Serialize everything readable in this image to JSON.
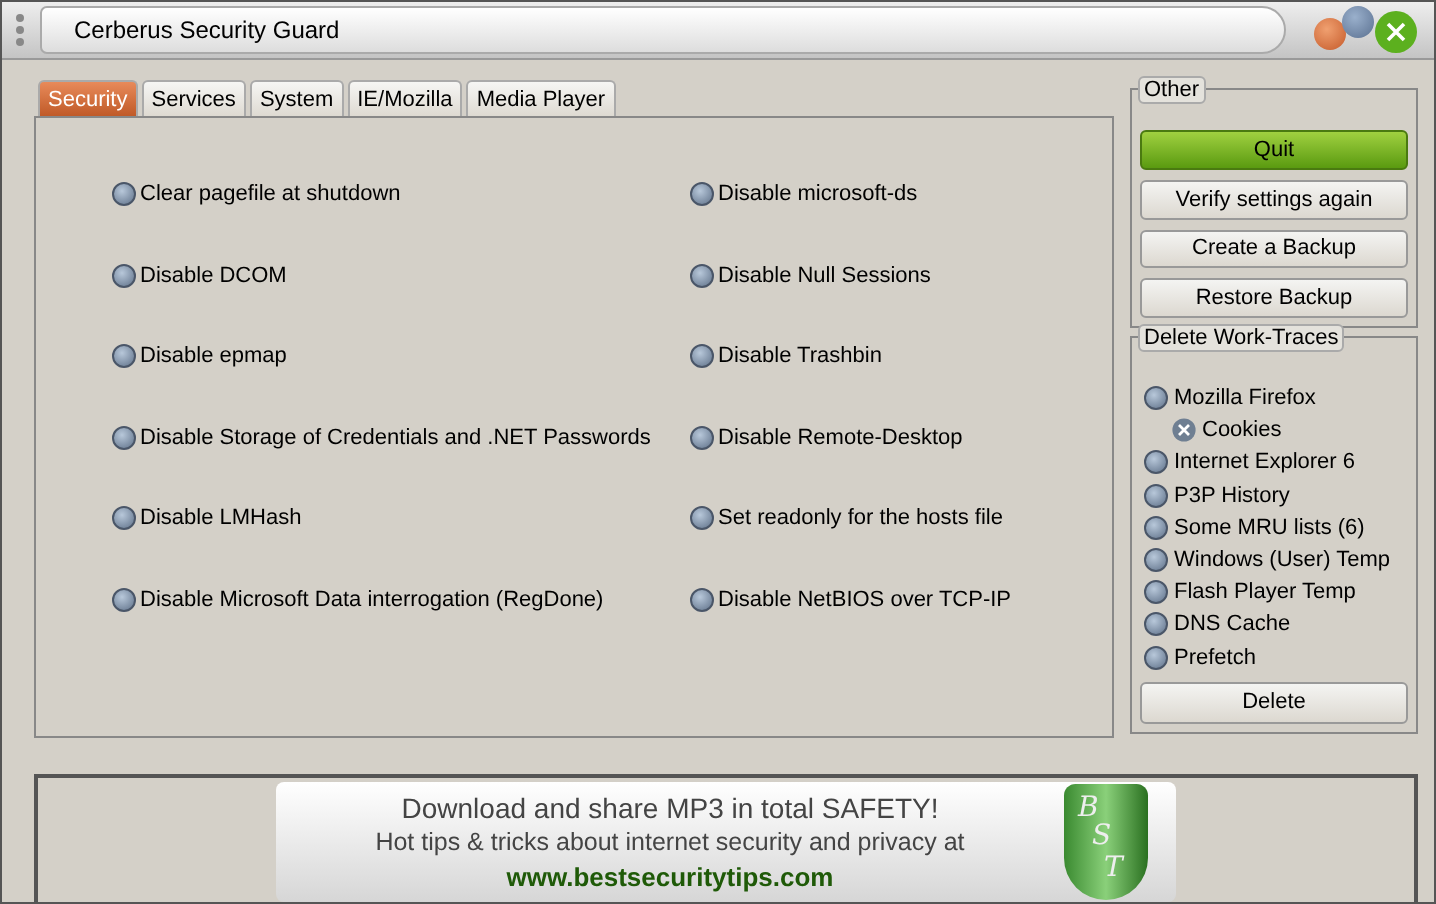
{
  "window": {
    "title": "Cerberus Security Guard"
  },
  "tabs": [
    {
      "label": "Security",
      "selected": true
    },
    {
      "label": "Services",
      "selected": false
    },
    {
      "label": "System",
      "selected": false
    },
    {
      "label": "IE/Mozilla",
      "selected": false
    },
    {
      "label": "Media Player",
      "selected": false
    }
  ],
  "options_left": [
    {
      "label": "Clear pagefile at shutdown",
      "checked": false
    },
    {
      "label": "Disable DCOM",
      "checked": false
    },
    {
      "label": "Disable epmap",
      "checked": false
    },
    {
      "label": "Disable Storage of Credentials and .NET Passwords",
      "checked": false
    },
    {
      "label": "Disable LMHash",
      "checked": false
    },
    {
      "label": "Disable Microsoft Data interrogation (RegDone)",
      "checked": false
    }
  ],
  "options_right": [
    {
      "label": "Disable microsoft-ds",
      "checked": false
    },
    {
      "label": "Disable Null Sessions",
      "checked": false
    },
    {
      "label": "Disable Trashbin",
      "checked": false
    },
    {
      "label": "Disable Remote-Desktop",
      "checked": false
    },
    {
      "label": "Set readonly for the hosts file",
      "checked": false
    },
    {
      "label": "Disable NetBIOS over TCP-IP",
      "checked": false
    }
  ],
  "other": {
    "title": "Other",
    "buttons": [
      {
        "label": "Quit",
        "kind": "primary"
      },
      {
        "label": "Verify settings again",
        "kind": "normal"
      },
      {
        "label": "Create a Backup",
        "kind": "normal"
      },
      {
        "label": "Restore Backup",
        "kind": "normal"
      }
    ]
  },
  "traces": {
    "title": "Delete Work-Traces",
    "items": [
      {
        "label": "Mozilla Firefox",
        "disabled": false,
        "children": [
          {
            "label": "Cookies",
            "disabled": true
          }
        ]
      },
      {
        "label": "Internet Explorer 6",
        "disabled": false
      },
      {
        "label": "P3P History",
        "disabled": false
      },
      {
        "label": "Some MRU lists (6)",
        "disabled": false
      },
      {
        "label": "Windows (User) Temp",
        "disabled": false
      },
      {
        "label": "Flash Player Temp",
        "disabled": false
      },
      {
        "label": "DNS Cache",
        "disabled": false
      },
      {
        "label": "Prefetch",
        "disabled": false
      }
    ],
    "button": "Delete"
  },
  "banner": {
    "line1": "Download and share MP3  in total SAFETY!",
    "line2": "Hot tips & tricks about internet security and privacy at",
    "link": "www.bestsecuritytips.com",
    "logo_letters": [
      "B",
      "S",
      "T"
    ]
  }
}
